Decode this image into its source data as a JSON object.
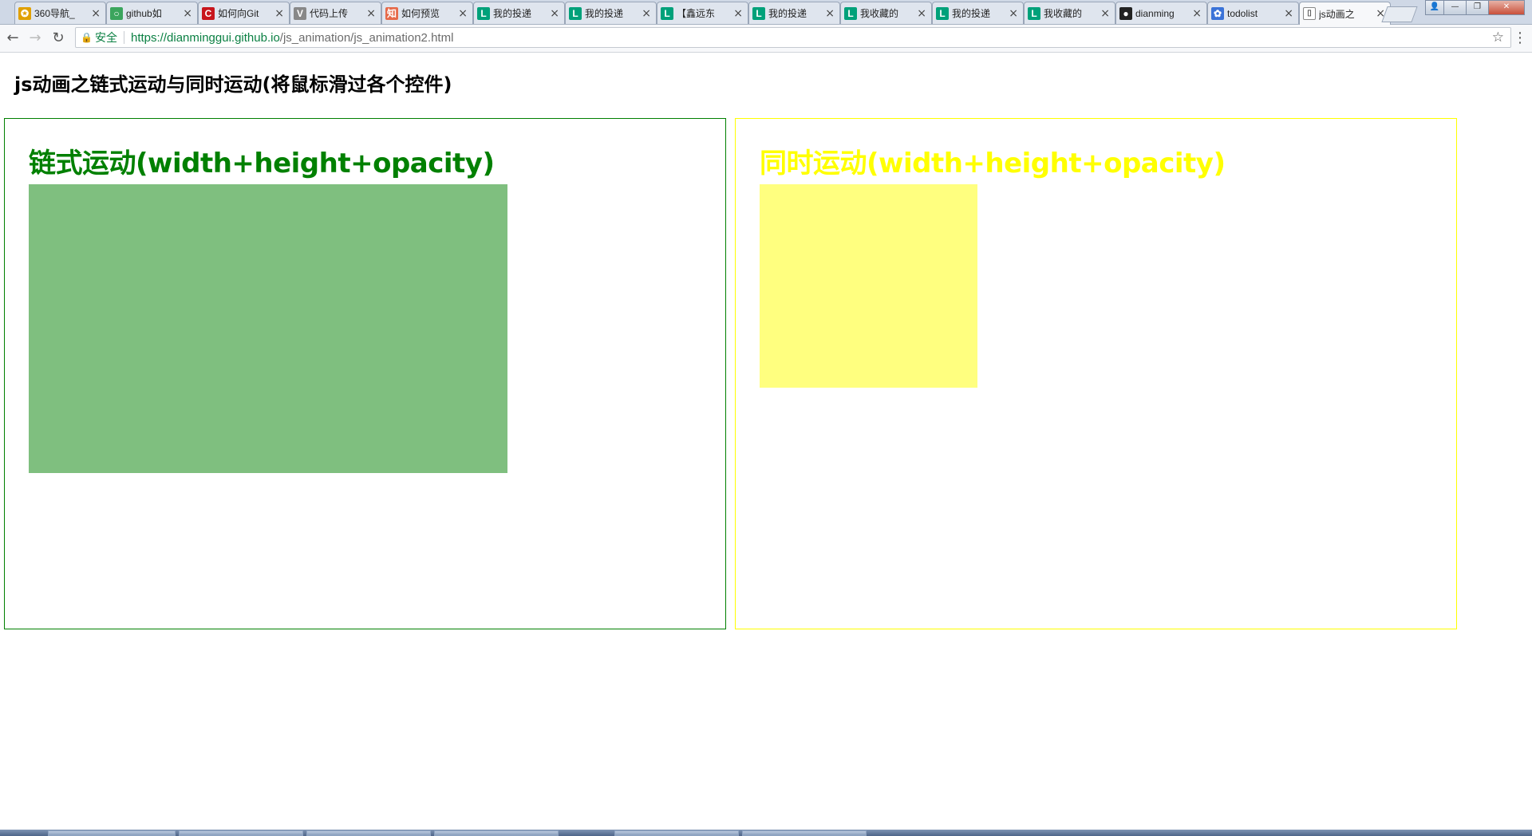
{
  "browser": {
    "tabs": [
      {
        "title": "360导航_",
        "favicon_color": "#e0a000",
        "favicon_glyph": "✪"
      },
      {
        "title": "github如",
        "favicon_color": "#3ba55d",
        "favicon_glyph": "○"
      },
      {
        "title": "如何向Git",
        "favicon_color": "#c8161d",
        "favicon_glyph": "C"
      },
      {
        "title": "代码上传",
        "favicon_color": "#888888",
        "favicon_glyph": "V"
      },
      {
        "title": "如何预览",
        "favicon_color": "#e66a4a",
        "favicon_glyph": "知"
      },
      {
        "title": "我的投递",
        "favicon_color": "#00a17a",
        "favicon_glyph": "L"
      },
      {
        "title": "我的投递",
        "favicon_color": "#00a17a",
        "favicon_glyph": "L"
      },
      {
        "title": "【鑫远东",
        "favicon_color": "#00a17a",
        "favicon_glyph": "L"
      },
      {
        "title": "我的投递",
        "favicon_color": "#00a17a",
        "favicon_glyph": "L"
      },
      {
        "title": "我收藏的",
        "favicon_color": "#00a17a",
        "favicon_glyph": "L"
      },
      {
        "title": "我的投递",
        "favicon_color": "#00a17a",
        "favicon_glyph": "L"
      },
      {
        "title": "我收藏的",
        "favicon_color": "#00a17a",
        "favicon_glyph": "L"
      },
      {
        "title": "dianming",
        "favicon_color": "#222222",
        "favicon_glyph": "●"
      },
      {
        "title": "todolist",
        "favicon_color": "#3b73d8",
        "favicon_glyph": "✿"
      },
      {
        "title": "js动画之",
        "favicon_color": "#ffffff",
        "favicon_glyph": "▯",
        "active": true
      }
    ],
    "close_glyph": "×",
    "address_bar": {
      "security_label": "安全",
      "url_host": "https://dianminggui.github.io",
      "url_path": "/js_animation/js_animation2.html"
    }
  },
  "page": {
    "title": "js动画之链式运动与同时运动(将鼠标滑过各个控件)",
    "panels": [
      {
        "heading": "链式运动(width+height+opacity)",
        "color": "#008000",
        "box_opacity": 0.5
      },
      {
        "heading": "同时运动(width+height+opacity)",
        "color": "#ffff00",
        "box_opacity": 0.5
      }
    ]
  },
  "icons": {
    "back": "back-arrow-icon",
    "forward": "forward-arrow-icon",
    "reload": "reload-icon",
    "lock": "lock-icon",
    "bookmark": "star-icon",
    "menu": "more-vert-icon"
  }
}
